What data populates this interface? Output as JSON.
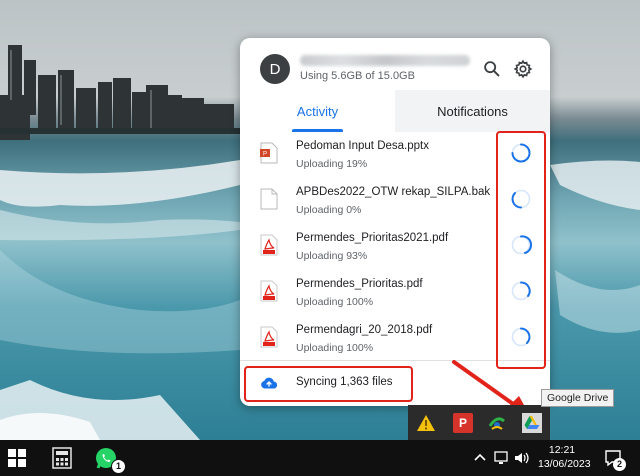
{
  "popup": {
    "avatar_letter": "D",
    "storage_text": "Using 5.6GB of 15.0GB",
    "header_icons": [
      "search-icon",
      "gear-icon"
    ],
    "tabs": [
      {
        "label": "Activity",
        "active": true
      },
      {
        "label": "Notifications",
        "active": false
      }
    ],
    "files": [
      {
        "name": "Pedoman Input Desa.pptx",
        "status": "Uploading 19%",
        "type": "pptx",
        "progress": 0.19
      },
      {
        "name": "APBDes2022_OTW rekap_SILPA.bak",
        "status": "Uploading 0%",
        "type": "generic",
        "progress": 0.0
      },
      {
        "name": "Permendes_Prioritas2021.pdf",
        "status": "Uploading 93%",
        "type": "pdf",
        "progress": 0.93
      },
      {
        "name": "Permendes_Prioritas.pdf",
        "status": "Uploading 100%",
        "type": "pdf",
        "progress": 1.0
      },
      {
        "name": "Permendagri_20_2018.pdf",
        "status": "Uploading 100%",
        "type": "pdf",
        "progress": 1.0
      }
    ],
    "sync_text": "Syncing 1,363 files"
  },
  "tooltip": "Google Drive",
  "taskbar": {
    "time": "12:21",
    "date": "13/06/2023",
    "notification_count": "2",
    "whatsapp_badge": "1",
    "pdf_tray_label": "P"
  },
  "colors": {
    "accent": "#1a73e8",
    "highlight": "#e2231a",
    "taskbar": "#101010"
  }
}
